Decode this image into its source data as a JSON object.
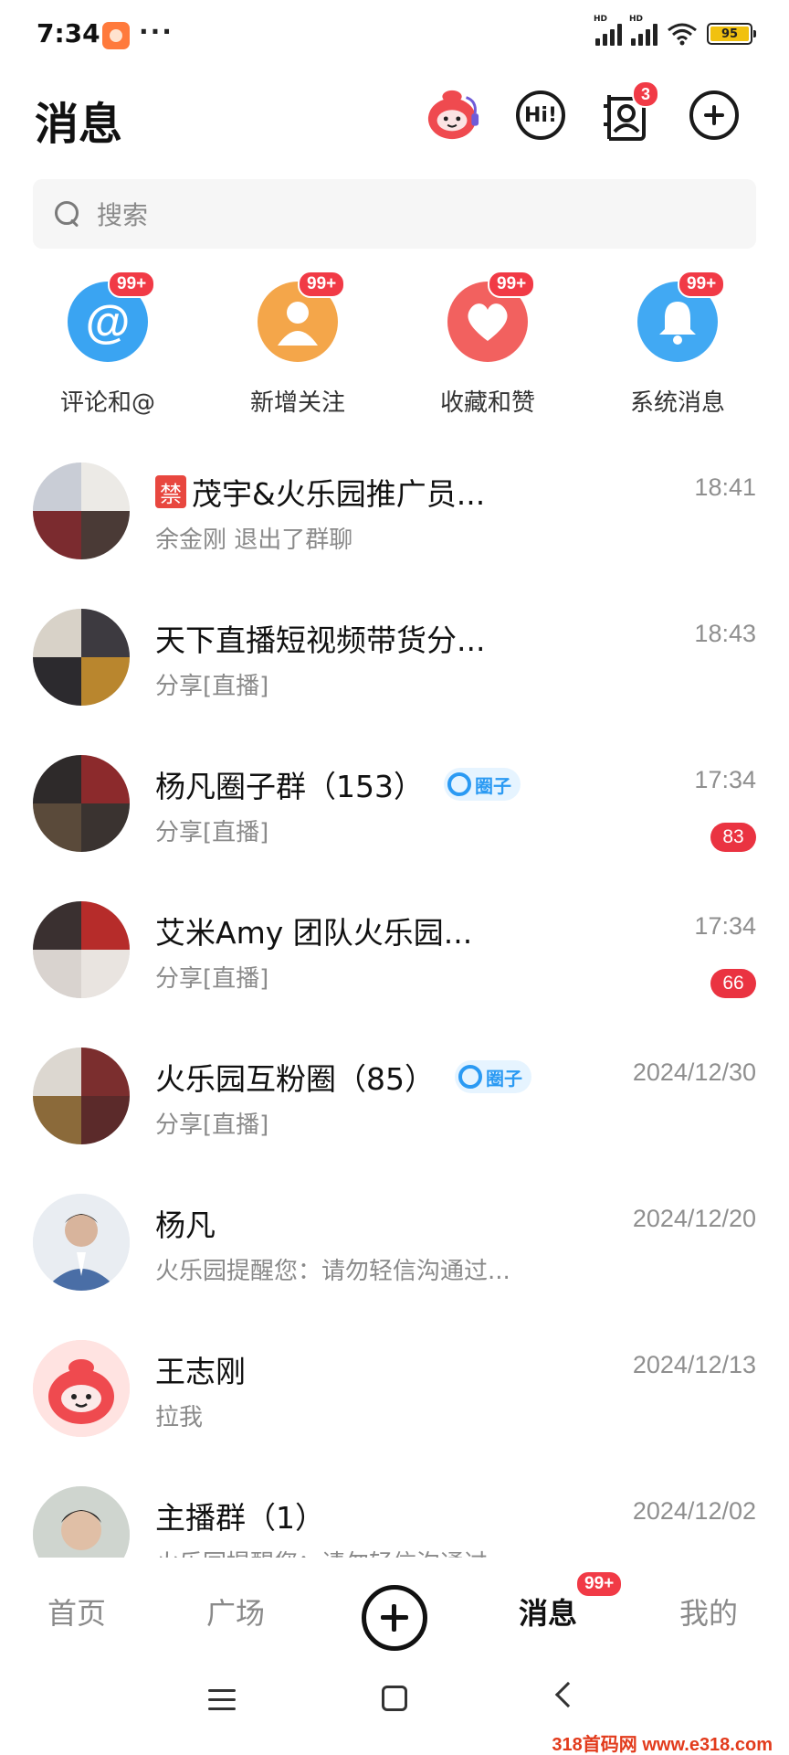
{
  "status_bar": {
    "time": "7:34",
    "more": "···",
    "signal_label_1": "HD",
    "signal_label_2": "HD",
    "battery": "95"
  },
  "header": {
    "title": "消息",
    "contacts_badge": "3",
    "hi_label": "Hi!"
  },
  "search": {
    "placeholder": "搜索"
  },
  "quick_actions": [
    {
      "label": "评论和@",
      "badge": "99+",
      "color": "#3aa4f2"
    },
    {
      "label": "新增关注",
      "badge": "99+",
      "color": "#f4a64a"
    },
    {
      "label": "收藏和赞",
      "badge": "99+",
      "color": "#f2615f"
    },
    {
      "label": "系统消息",
      "badge": "99+",
      "color": "#41a9f3"
    }
  ],
  "conversations": [
    {
      "name": "茂宇&火乐园推广员...",
      "tag": "禁",
      "preview": "余金刚 退出了群聊",
      "time": "18:41",
      "unread": ""
    },
    {
      "name": "天下直播短视频带货分...",
      "preview": "分享[直播]",
      "time": "18:43",
      "unread": ""
    },
    {
      "name": "杨凡圈子群（153）",
      "circle_tag": "圈子",
      "preview": "分享[直播]",
      "time": "17:34",
      "unread": "83"
    },
    {
      "name": "艾米Amy 团队火乐园...",
      "preview": "分享[直播]",
      "time": "17:34",
      "unread": "66"
    },
    {
      "name": "火乐园互粉圈（85）",
      "circle_tag": "圈子",
      "preview": "分享[直播]",
      "time": "2024/12/30",
      "unread": ""
    },
    {
      "name": "杨凡",
      "preview": "火乐园提醒您：请勿轻信沟通过...",
      "time": "2024/12/20",
      "unread": ""
    },
    {
      "name": "王志刚",
      "preview": "拉我",
      "time": "2024/12/13",
      "unread": ""
    },
    {
      "name": "主播群（1）",
      "preview": "火乐园提醒您：请勿轻信沟通过...",
      "time": "2024/12/02",
      "unread": ""
    }
  ],
  "bottom_nav": {
    "home": "首页",
    "plaza": "广场",
    "messages": "消息",
    "messages_badge": "99+",
    "mine": "我的"
  },
  "watermark": "318首码网 www.e318.com",
  "colors": {
    "accent_red": "#ea3341",
    "circle_blue": "#2b9af3"
  }
}
